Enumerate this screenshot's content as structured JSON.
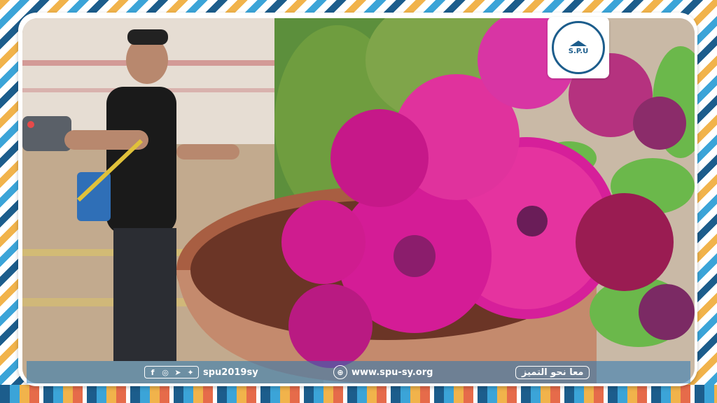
{
  "logo": {
    "abbr": "S.P.U"
  },
  "info_bar": {
    "social_handle": "spu2019sy",
    "website": "www.spu-sy.org",
    "slogan": "معا نحو التميز",
    "social_icons": [
      "facebook-icon",
      "instagram-icon",
      "telegram-icon",
      "twitter-icon"
    ]
  },
  "colors": {
    "brand_blue": "#1c5d8c",
    "accent_yellow": "#f1b34b",
    "accent_light_blue": "#3ba4d8",
    "flower_magenta": "#d61f9a"
  }
}
